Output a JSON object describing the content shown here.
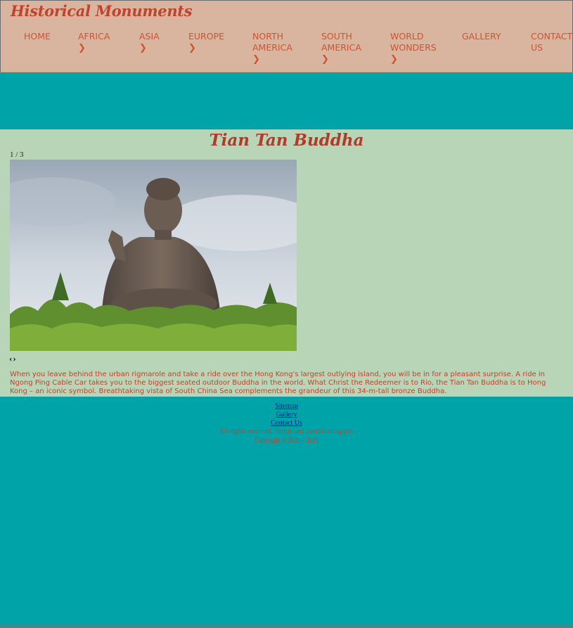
{
  "site": {
    "logo": "Historical Monuments"
  },
  "nav": {
    "items": [
      {
        "line1": "HOME",
        "line2": "",
        "chevron": false
      },
      {
        "line1": "AFRICA",
        "line2": "",
        "chevron": true
      },
      {
        "line1": "ASIA",
        "line2": "",
        "chevron": true
      },
      {
        "line1": "EUROPE",
        "line2": "",
        "chevron": true
      },
      {
        "line1": "NORTH",
        "line2": "AMERICA",
        "chevron": true
      },
      {
        "line1": "SOUTH",
        "line2": "AMERICA",
        "chevron": true
      },
      {
        "line1": "WORLD",
        "line2": "WONDERS",
        "chevron": true
      },
      {
        "line1": "GALLERY",
        "line2": "",
        "chevron": false
      },
      {
        "line1": "CONTACT",
        "line2": "US",
        "chevron": false
      }
    ]
  },
  "main": {
    "title": "Tian Tan Buddha",
    "counter": "1 / 3",
    "prev_glyph": "‹",
    "next_glyph": "›",
    "description": "When you leave behind the urban rigmarole and take a ride over the Hong Kong's largest outlying island, you will be in for a pleasant surprise. A ride in Ngong Ping Cable Car takes you to the biggest seated outdoor Buddha in the world. What Christ the Redeemer is to Rio, the Tian Tan Buddha is to Hong Kong – an iconic symbol. Breathtaking vista of South China Sea complements the grandeur of this 34-m-tall bronze Buddha."
  },
  "footer": {
    "links": [
      "Sitemap",
      "Gallery",
      "Contact Us"
    ],
    "rights": "All rights reserved. Terms and conditions apply.",
    "copyright": "Copyright © 2021 - 2021"
  },
  "colors": {
    "header_bg": "#d9b5a0",
    "teal": "#00a4a8",
    "content_bg": "#b8d5b8",
    "accent": "#c0432c"
  },
  "icons": {
    "chevron": "chevron-right-icon"
  }
}
